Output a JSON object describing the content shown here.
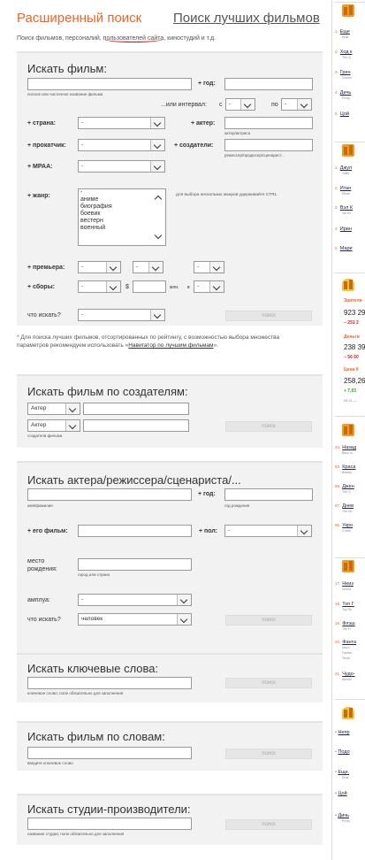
{
  "header": {
    "title": "Расширенный поиск",
    "best_films_link": "Поиск лучших фильмов",
    "subtitle_pre": "Поиск фильмов, персоналий, ",
    "subtitle_underlined": "пользователей сайта",
    "subtitle_post": ", киностудий и т.д."
  },
  "film_search": {
    "title": "Искать фильм:",
    "name_hint": "полное или частичное название фильма",
    "year_label": "+ год:",
    "interval_label": "...или интервал:",
    "interval_from": "с",
    "interval_from_value": "-",
    "interval_to": "по",
    "interval_to_value": "-",
    "country_label": "+ страна:",
    "country_value": "-",
    "actor_label": "+ актер:",
    "actor_hint": "актер/актриса",
    "distributor_label": "+ прокатчик:",
    "distributor_value": "-",
    "creators_label": "+ создатели:",
    "creators_hint": "режиссер/продюсер/сценарист...",
    "mpaa_label": "+ MPAA:",
    "mpaa_value": "-",
    "genre_label": "+ жанр:",
    "genre_options": [
      "-",
      "аниме",
      "биография",
      "боевик",
      "вестерн",
      "военный"
    ],
    "genre_hint": "для выбора нескольких жанров удерживайте CTRL",
    "premiere_label": "+ премьера:",
    "premiere_values": [
      "-",
      "-",
      "-"
    ],
    "boxoffice_label": "+ сборы:",
    "boxoffice_first": "-",
    "boxoffice_currency": "$",
    "boxoffice_unit": "млн.",
    "boxoffice_in": "в",
    "boxoffice_last": "-",
    "what_label": "что искать?",
    "what_value": "-",
    "search_button": "поиск"
  },
  "note": {
    "text_pre": "* Для поиска лучших фильмов, отсортированных по рейтингу, с возможностью выбора множества параметров рекомендуем использовать «",
    "link": "Навигатор по лучшим фильмам",
    "text_post": "»."
  },
  "by_creators": {
    "title": "Искать фильм по создателям:",
    "role1": "Актер",
    "role2": "Актер",
    "hint": "создатели фильма",
    "search_button": "поиск"
  },
  "person_search": {
    "title": "Искать актера/режиссера/сценариста/...",
    "name_hint": "имя/фамилия",
    "year_label": "+ год:",
    "year_hint": "год рождения",
    "film_label": "+ его фильм:",
    "gender_label": "+ пол:",
    "gender_value": "-",
    "birthplace_label_1": "место",
    "birthplace_label_2": "рождения:",
    "birthplace_hint": "город или страна",
    "role_label": "амплуа:",
    "role_value": "-",
    "what_label": "что искать?",
    "what_value": "человек",
    "search_button": "поиск"
  },
  "keywords": {
    "title": "Искать ключевые слова:",
    "hint": "ключевое слово; поле обязательно для заполнения",
    "search_button": "поиск"
  },
  "by_words": {
    "title": "Искать фильм по словам:",
    "hint": "введите ключевое слово",
    "search_button": "поиск"
  },
  "studios": {
    "title": "Искать студии-производители:",
    "hint": "название студии; поле обязательно для заполнения",
    "search_button": "поиск"
  },
  "sidebar": {
    "block1": [
      {
        "n": "1.",
        "t": "Еще",
        "s": "Druk"
      },
      {
        "n": "2.",
        "t": "Ход к",
        "s": "The Q"
      },
      {
        "n": "3.",
        "t": "Грен",
        "s": "Groom"
      },
      {
        "n": "4.",
        "t": "Дичь",
        "s": "Proxy"
      },
      {
        "n": "5.",
        "t": "Цой",
        "s": ""
      }
    ],
    "block2": [
      {
        "n": "1.",
        "t": "Джул",
        "s": "Juliet"
      },
      {
        "n": "2.",
        "t": "Итан",
        "s": "Ethan"
      },
      {
        "n": "3.",
        "t": "Вэл К",
        "s": "Val Kil"
      },
      {
        "n": "4.",
        "t": "Ирин",
        "s": ""
      },
      {
        "n": "5.",
        "t": "Мари",
        "s": ""
      }
    ],
    "stats": {
      "viewers_label": "Зрители",
      "viewers_value": "923 29",
      "viewers_delta": "− 251 2",
      "money_label": "Деньги",
      "money_value": "238 39",
      "money_delta": "− 56 60",
      "price_label": "Цена б",
      "price_value": "258,26",
      "price_delta": "+ 7,03",
      "date": "08.11 —"
    },
    "block3": [
      {
        "n": "34.",
        "t": "Назад",
        "s": "Back to"
      },
      {
        "n": "83.",
        "t": "Краса",
        "s": "Beauty"
      },
      {
        "n": "88.",
        "t": "Джен",
        "s": "The G"
      },
      {
        "n": "87.",
        "t": "Днев",
        "s": "The No"
      },
      {
        "n": "95.",
        "t": "Укро",
        "s": "3 Idiot"
      }
    ],
    "block4": [
      {
        "n": "17.",
        "t": "Неиз",
        "s": "Uncha"
      },
      {
        "n": "18.",
        "t": "Топ Г",
        "s": "Top Gu"
      },
      {
        "n": "19.",
        "t": "Флэш",
        "s": "The Fl"
      },
      {
        "n": "20.",
        "t": "Фанта",
        "s": "Fantas"
      },
      {
        "n": "21.",
        "t": "Чудо-",
        "s": "Wonde"
      }
    ],
    "block4_extra": [
      "они о",
      "Thom"
    ],
    "block5": [
      {
        "t": "Непр",
        "s": ""
      },
      {
        "t": "Подо",
        "s": ""
      },
      {
        "t": "Еще.",
        "s": "Druk"
      },
      {
        "t": "Цой",
        "s": ""
      },
      {
        "t": "Дичь",
        "s": "Proxy"
      }
    ]
  }
}
